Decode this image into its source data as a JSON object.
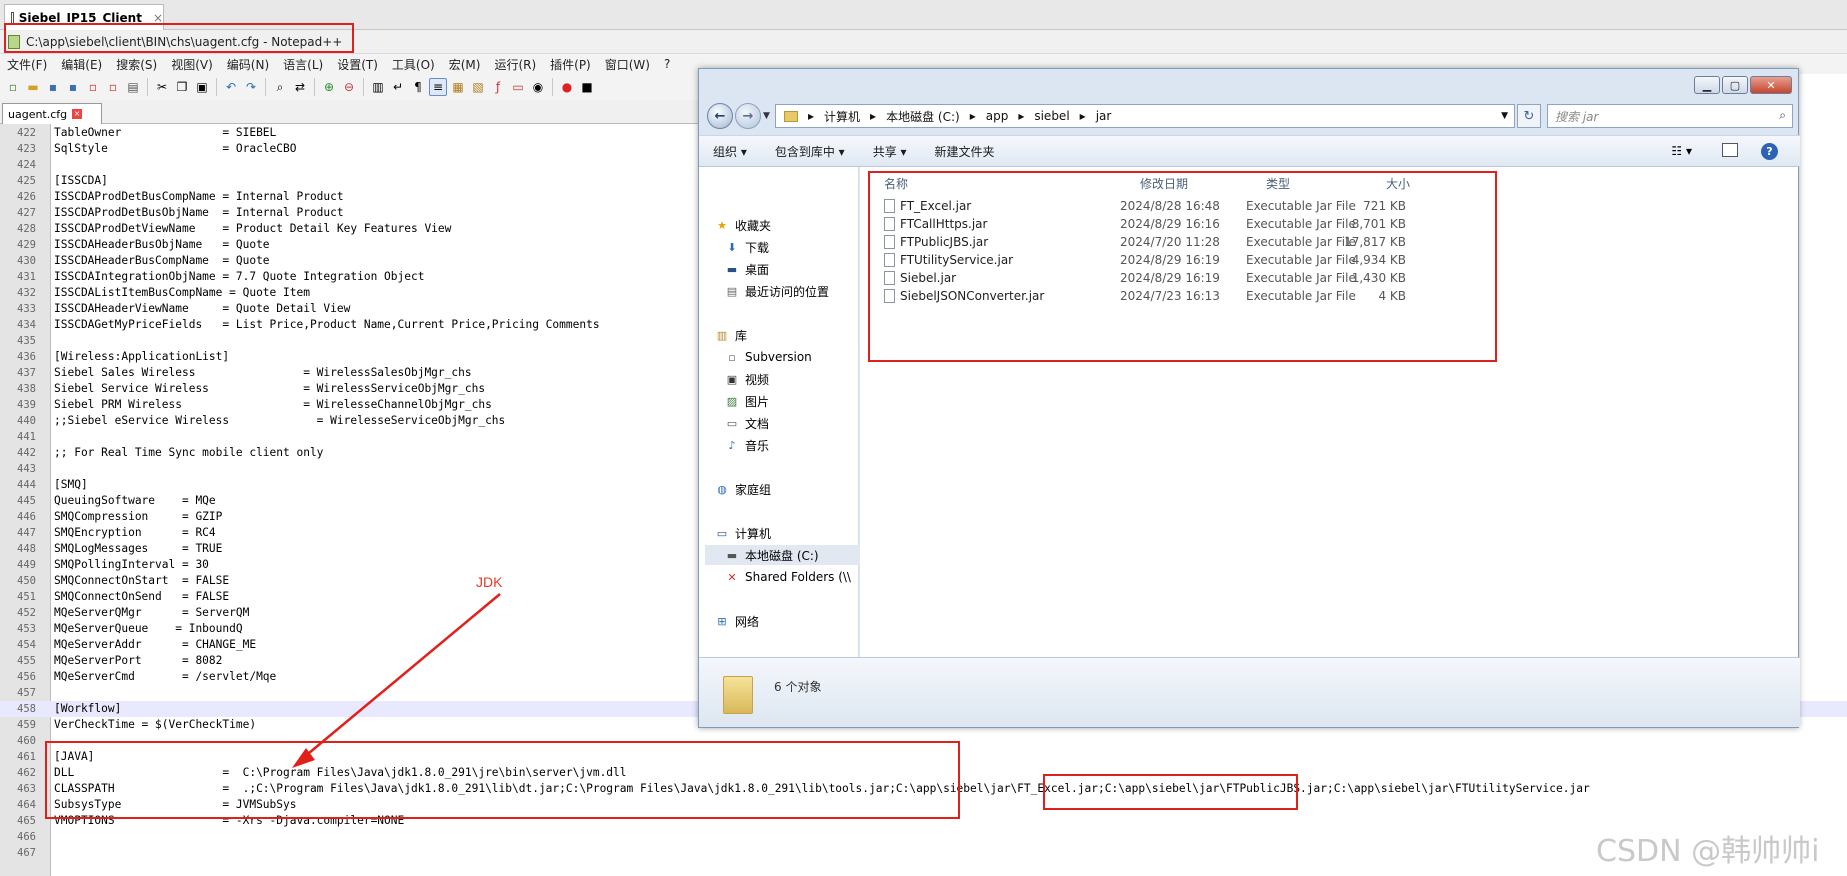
{
  "host_tab": {
    "title": "Siebel_IP15_Client",
    "close": "×"
  },
  "notepad": {
    "title": "C:\\app\\siebel\\client\\BIN\\chs\\uagent.cfg - Notepad++",
    "menu": [
      "文件(F)",
      "编辑(E)",
      "搜索(S)",
      "视图(V)",
      "编码(N)",
      "语言(L)",
      "设置(T)",
      "工具(O)",
      "宏(M)",
      "运行(R)",
      "插件(P)",
      "窗口(W)",
      "?"
    ],
    "file_tab": "uagent.cfg",
    "lines": [
      {
        "n": "422",
        "t": "TableOwner               = SIEBEL"
      },
      {
        "n": "423",
        "t": "SqlStyle                 = OracleCBO"
      },
      {
        "n": "424",
        "t": ""
      },
      {
        "n": "425",
        "t": "[ISSCDA]"
      },
      {
        "n": "426",
        "t": "ISSCDAProdDetBusCompName = Internal Product"
      },
      {
        "n": "427",
        "t": "ISSCDAProdDetBusObjName  = Internal Product"
      },
      {
        "n": "428",
        "t": "ISSCDAProdDetViewName    = Product Detail Key Features View"
      },
      {
        "n": "429",
        "t": "ISSCDAHeaderBusObjName   = Quote"
      },
      {
        "n": "430",
        "t": "ISSCDAHeaderBusCompName  = Quote"
      },
      {
        "n": "431",
        "t": "ISSCDAIntegrationObjName = 7.7 Quote Integration Object"
      },
      {
        "n": "432",
        "t": "ISSCDAListItemBusCompName = Quote Item"
      },
      {
        "n": "433",
        "t": "ISSCDAHeaderViewName     = Quote Detail View"
      },
      {
        "n": "434",
        "t": "ISSCDAGetMyPriceFields   = List Price,Product Name,Current Price,Pricing Comments"
      },
      {
        "n": "435",
        "t": ""
      },
      {
        "n": "436",
        "t": "[Wireless:ApplicationList]"
      },
      {
        "n": "437",
        "t": "Siebel Sales Wireless                = WirelessSalesObjMgr_chs"
      },
      {
        "n": "438",
        "t": "Siebel Service Wireless              = WirelessServiceObjMgr_chs"
      },
      {
        "n": "439",
        "t": "Siebel PRM Wireless                  = WirelesseChannelObjMgr_chs"
      },
      {
        "n": "440",
        "t": ";;Siebel eService Wireless             = WirelesseServiceObjMgr_chs"
      },
      {
        "n": "441",
        "t": ""
      },
      {
        "n": "442",
        "t": ";; For Real Time Sync mobile client only"
      },
      {
        "n": "443",
        "t": ""
      },
      {
        "n": "444",
        "t": "[SMQ]"
      },
      {
        "n": "445",
        "t": "QueuingSoftware    = MQe"
      },
      {
        "n": "446",
        "t": "SMQCompression     = GZIP"
      },
      {
        "n": "447",
        "t": "SMQEncryption      = RC4"
      },
      {
        "n": "448",
        "t": "SMQLogMessages     = TRUE"
      },
      {
        "n": "449",
        "t": "SMQPollingInterval = 30"
      },
      {
        "n": "450",
        "t": "SMQConnectOnStart  = FALSE"
      },
      {
        "n": "451",
        "t": "SMQConnectOnSend   = FALSE"
      },
      {
        "n": "452",
        "t": "MQeServerQMgr      = ServerQM"
      },
      {
        "n": "453",
        "t": "MQeServerQueue    = InboundQ"
      },
      {
        "n": "454",
        "t": "MQeServerAddr      = CHANGE_ME"
      },
      {
        "n": "455",
        "t": "MQeServerPort      = 8082"
      },
      {
        "n": "456",
        "t": "MQeServerCmd       = /servlet/Mqe"
      },
      {
        "n": "457",
        "t": ""
      },
      {
        "n": "458",
        "t": "[Workflow]"
      },
      {
        "n": "459",
        "t": "VerCheckTime = $(VerCheckTime)"
      },
      {
        "n": "460",
        "t": ""
      },
      {
        "n": "461",
        "t": "[JAVA]"
      },
      {
        "n": "462",
        "t": "DLL                      =  C:\\Program Files\\Java\\jdk1.8.0_291\\jre\\bin\\server\\jvm.dll"
      },
      {
        "n": "463",
        "t": "CLASSPATH                =  .;C:\\Program Files\\Java\\jdk1.8.0_291\\lib\\dt.jar;C:\\Program Files\\Java\\jdk1.8.0_291\\lib\\tools.jar;C:\\app\\siebel\\jar\\FT_Excel.jar;C:\\app\\siebel\\jar\\FTPublicJBS.jar;C:\\app\\siebel\\jar\\FTUtilityService.jar"
      },
      {
        "n": "464",
        "t": "SubsysType               = JVMSubSys"
      },
      {
        "n": "465",
        "t": "VMOPTIONS                = -Xrs -Djava.compiler=NONE"
      },
      {
        "n": "466",
        "t": ""
      },
      {
        "n": "467",
        "t": ""
      }
    ]
  },
  "explorer": {
    "breadcrumb": [
      "计算机",
      "本地磁盘 (C:)",
      "app",
      "siebel",
      "jar"
    ],
    "search_placeholder": "搜索 jar",
    "commands": [
      "组织 ▾",
      "包含到库中 ▾",
      "共享 ▾",
      "新建文件夹"
    ],
    "nav": {
      "favorites": "收藏夹",
      "favorites_items": [
        "下载",
        "桌面",
        "最近访问的位置"
      ],
      "libraries": "库",
      "libraries_items": [
        "Subversion",
        "视频",
        "图片",
        "文档",
        "音乐"
      ],
      "homegroup": "家庭组",
      "computer": "计算机",
      "computer_items": [
        "本地磁盘 (C:)",
        "Shared Folders (\\\\"
      ],
      "network": "网络"
    },
    "columns": {
      "name": "名称",
      "date": "修改日期",
      "type": "类型",
      "size": "大小"
    },
    "files": [
      {
        "name": "FT_Excel.jar",
        "date": "2024/8/28 16:48",
        "type": "Executable Jar File",
        "size": "721 KB"
      },
      {
        "name": "FTCallHttps.jar",
        "date": "2024/8/29 16:16",
        "type": "Executable Jar File",
        "size": "8,701 KB"
      },
      {
        "name": "FTPublicJBS.jar",
        "date": "2024/7/20 11:28",
        "type": "Executable Jar File",
        "size": "17,817 KB"
      },
      {
        "name": "FTUtilityService.jar",
        "date": "2024/8/29 16:19",
        "type": "Executable Jar File",
        "size": "4,934 KB"
      },
      {
        "name": "Siebel.jar",
        "date": "2024/8/29 16:19",
        "type": "Executable Jar File",
        "size": "1,430 KB"
      },
      {
        "name": "SiebelJSONConverter.jar",
        "date": "2024/7/23 16:13",
        "type": "Executable Jar File",
        "size": "4 KB"
      }
    ],
    "object_count": "6 个对象"
  },
  "annotation": {
    "label": "JDK",
    "color": "#e0211b"
  },
  "watermark": "CSDN @韩帅帅i"
}
